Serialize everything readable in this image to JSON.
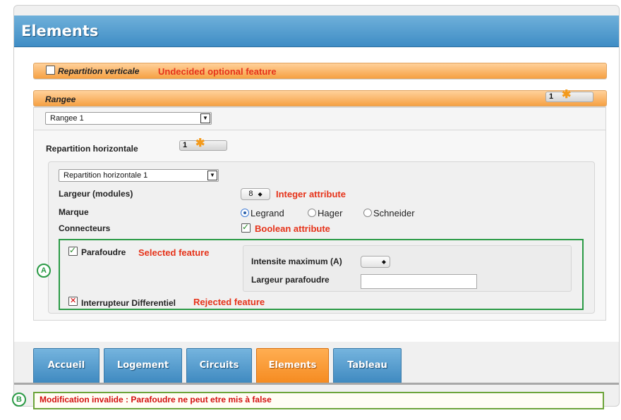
{
  "header": {
    "title": "Elements"
  },
  "repartition_verticale": {
    "label": "Repartition verticale",
    "checked": false,
    "annotation": "Undecided optional feature"
  },
  "rangee": {
    "label": "Rangee",
    "count": "1",
    "selected": "Rangee 1"
  },
  "repartition_horizontale": {
    "label": "Repartition horizontale",
    "count": "1",
    "selected": "Repartition horizontale 1"
  },
  "fields": {
    "largeur": {
      "label": "Largeur (modules)",
      "value": "8",
      "annotation": "Integer attribute"
    },
    "marque": {
      "label": "Marque",
      "options": [
        "Legrand",
        "Hager",
        "Schneider"
      ],
      "selected": "Legrand"
    },
    "connecteurs": {
      "label": "Connecteurs",
      "checked": true,
      "annotation": "Boolean attribute"
    }
  },
  "parafoudre": {
    "label": "Parafoudre",
    "checked": true,
    "annotation": "Selected feature",
    "intensite_label": "Intensite maximum (A)",
    "intensite_value": "",
    "largeur_label": "Largeur parafoudre",
    "largeur_value": ""
  },
  "interrupteur": {
    "label": "Interrupteur Differentiel",
    "rejected": true,
    "annotation": "Rejected feature"
  },
  "markers": {
    "a": "A",
    "b": "B"
  },
  "tabs": [
    {
      "label": "Accueil",
      "active": false
    },
    {
      "label": "Logement",
      "active": false
    },
    {
      "label": "Circuits",
      "active": false
    },
    {
      "label": "Elements",
      "active": true
    },
    {
      "label": "Tableau",
      "active": false
    }
  ],
  "status": {
    "message": "Modification invalide : Parafoudre ne peut etre mis à false"
  },
  "colors": {
    "header_blue": "#3f8dc5",
    "orange_accent": "#f6a144",
    "annotation_red": "#e6331a",
    "green_outline": "#2a9a45",
    "error_red": "#d40f0f"
  },
  "icons": [
    "checkbox-icon",
    "asterisk-icon",
    "dropdown-arrow-icon",
    "radio-icon",
    "rejected-x-icon"
  ]
}
